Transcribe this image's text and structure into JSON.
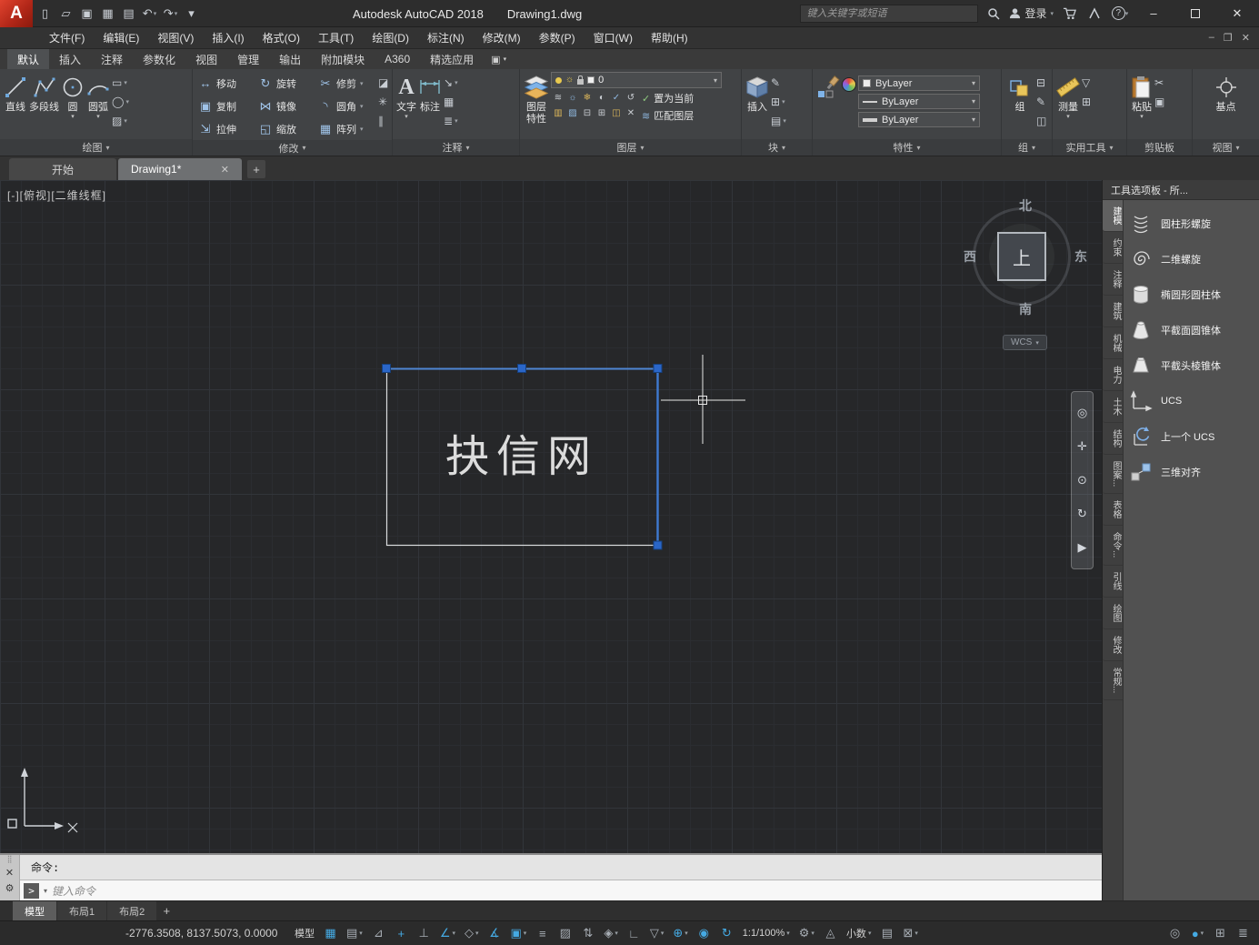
{
  "ui": {
    "caret_down": "▾",
    "close": "✕",
    "plus": "+",
    "minimize": "–",
    "restore": "❐",
    "menu_grip": "⣿",
    "gear": "⚙",
    "prompt": ">",
    "question": "?"
  },
  "titlebar": {
    "app_title": "Autodesk AutoCAD 2018",
    "doc_title": "Drawing1.dwg",
    "search_placeholder": "键入关键字或短语",
    "login_label": "登录",
    "quick_access": [
      {
        "name": "new-file-icon",
        "glyph": "▯"
      },
      {
        "name": "open-folder-icon",
        "glyph": "▱"
      },
      {
        "name": "save-icon",
        "glyph": "▣"
      },
      {
        "name": "save-as-icon",
        "glyph": "▦"
      },
      {
        "name": "plot-icon",
        "glyph": "▤"
      },
      {
        "name": "undo-icon",
        "glyph": "↶",
        "caret": "▾"
      },
      {
        "name": "redo-icon",
        "glyph": "↷",
        "caret": "▾"
      },
      {
        "name": "toolbar-customize-icon",
        "glyph": "▾"
      }
    ]
  },
  "menubar": {
    "items": [
      "文件(F)",
      "编辑(E)",
      "视图(V)",
      "插入(I)",
      "格式(O)",
      "工具(T)",
      "绘图(D)",
      "标注(N)",
      "修改(M)",
      "参数(P)",
      "窗口(W)",
      "帮助(H)"
    ]
  },
  "ribbon": {
    "tabs": [
      {
        "label": "默认",
        "active": true
      },
      {
        "label": "插入"
      },
      {
        "label": "注释"
      },
      {
        "label": "参数化"
      },
      {
        "label": "视图"
      },
      {
        "label": "管理"
      },
      {
        "label": "输出"
      },
      {
        "label": "附加模块"
      },
      {
        "label": "A360"
      },
      {
        "label": "精选应用"
      }
    ],
    "draw": {
      "title": "绘图",
      "line": "直线",
      "polyline": "多段线",
      "circle": "圆",
      "arc": "圆弧",
      "extra": [
        {
          "name": "rectangle-tool",
          "glyph": "▭",
          "caret": "▾"
        },
        {
          "name": "ellipse-tool",
          "glyph": "◯",
          "caret": "▾"
        },
        {
          "name": "hatch-tool",
          "glyph": "▨",
          "caret": "▾"
        }
      ]
    },
    "modify": {
      "title": "修改",
      "grid": [
        {
          "glyph": "↔",
          "label": "移动"
        },
        {
          "glyph": "↻",
          "label": "旋转"
        },
        {
          "glyph": "✂",
          "label": "修剪",
          "caret": "▾"
        },
        {
          "glyph": "▣",
          "label": "复制"
        },
        {
          "glyph": "⋈",
          "label": "镜像"
        },
        {
          "glyph": "◝",
          "label": "圆角",
          "caret": "▾"
        },
        {
          "glyph": "⇲",
          "label": "拉伸"
        },
        {
          "glyph": "◱",
          "label": "缩放"
        },
        {
          "glyph": "▦",
          "label": "阵列",
          "caret": "▾"
        }
      ],
      "extra": [
        {
          "name": "erase-tool",
          "glyph": "◪"
        },
        {
          "name": "explode-tool",
          "glyph": "✳"
        },
        {
          "name": "offset-tool",
          "glyph": "∥"
        }
      ]
    },
    "annotation": {
      "title": "注释",
      "text": "文字",
      "dimension": "标注",
      "extra": [
        {
          "name": "leader-tool",
          "glyph": "↘",
          "caret": "▾"
        },
        {
          "name": "table-tool",
          "glyph": "▦"
        },
        {
          "name": "dim-style-tool",
          "glyph": "≣",
          "caret": "▾"
        }
      ]
    },
    "layers": {
      "title": "图层",
      "props_line1": "图层",
      "props_line2": "特性",
      "combo_value": "0",
      "set_current": "置为当前",
      "match_layer": "匹配图层",
      "tools": [
        "≋",
        "☼",
        "❄",
        "◐",
        "✓",
        "↺",
        "▥",
        "▨",
        "⊟",
        "⊞",
        "◫",
        "✕"
      ]
    },
    "block": {
      "title": "块",
      "insert": "插入",
      "extra": [
        {
          "name": "block-edit-tool",
          "glyph": "✎"
        },
        {
          "name": "block-create-tool",
          "glyph": "⊞",
          "caret": "▾"
        },
        {
          "name": "block-attribute-tool",
          "glyph": "▤",
          "caret": "▾"
        }
      ]
    },
    "properties": {
      "title": "特性",
      "rows": [
        {
          "value": "ByLayer"
        },
        {
          "value": "ByLayer"
        },
        {
          "value": "ByLayer"
        }
      ]
    },
    "groups": {
      "title": "组",
      "group": "组",
      "extra": [
        {
          "name": "ungroup-tool",
          "glyph": "⊟"
        },
        {
          "name": "group-edit-tool",
          "glyph": "✎"
        },
        {
          "name": "group-select-tool",
          "glyph": "◫"
        }
      ]
    },
    "utilities": {
      "title": "实用工具",
      "measure": "测量",
      "extra": [
        {
          "name": "quick-select-tool",
          "glyph": "▽"
        },
        {
          "name": "quick-calc-tool",
          "glyph": "⊞"
        }
      ]
    },
    "clipboard": {
      "title": "剪贴板",
      "paste": "粘贴",
      "extra": [
        {
          "name": "cut-tool",
          "glyph": "✂"
        },
        {
          "name": "copy-clip-tool",
          "glyph": "▣"
        }
      ]
    },
    "view": {
      "title": "视图",
      "base": "基点"
    }
  },
  "filetabs": {
    "start": "开始",
    "drawing": "Drawing1*"
  },
  "canvas": {
    "viewport_label": "[-][俯视][二维线框]",
    "text_object": "抉信网",
    "viewcube": {
      "north": "北",
      "south": "南",
      "west": "西",
      "east": "东",
      "top": "上",
      "wcs": "WCS"
    },
    "navbar": [
      {
        "name": "steering-wheel-icon",
        "glyph": "◎"
      },
      {
        "name": "pan-icon",
        "glyph": "✛"
      },
      {
        "name": "zoom-icon",
        "glyph": "⊙"
      },
      {
        "name": "orbit-icon",
        "glyph": "↻"
      },
      {
        "name": "show-motion-icon",
        "glyph": "▶"
      }
    ]
  },
  "palette": {
    "title": "工具选项板 - 所...",
    "tabs": [
      {
        "label": "建模",
        "active": true
      },
      {
        "label": "约束"
      },
      {
        "label": "注释"
      },
      {
        "label": "建筑"
      },
      {
        "label": "机械"
      },
      {
        "label": "电力"
      },
      {
        "label": "土木"
      },
      {
        "label": "结构"
      },
      {
        "label": "图案..."
      },
      {
        "label": "表格"
      },
      {
        "label": "命令..."
      },
      {
        "label": "引线"
      },
      {
        "label": "绘图"
      },
      {
        "label": "修改"
      },
      {
        "label": "常规..."
      }
    ],
    "items": [
      {
        "label": "圆柱形螺旋"
      },
      {
        "label": "二维螺旋"
      },
      {
        "label": "椭圆形圆柱体"
      },
      {
        "label": "平截面圆锥体"
      },
      {
        "label": "平截头棱锥体"
      },
      {
        "label": "UCS"
      },
      {
        "label": "上一个 UCS"
      },
      {
        "label": "三维对齐"
      }
    ]
  },
  "command": {
    "prompt": "命令:",
    "placeholder": "键入命令"
  },
  "layouts": {
    "tabs": [
      {
        "label": "模型",
        "active": true
      },
      {
        "label": "布局1"
      },
      {
        "label": "布局2"
      }
    ]
  },
  "statusbar": {
    "coordinates": "-2776.3508, 8137.5073, 0.0000",
    "icons": [
      {
        "name": "model-paper-toggle",
        "text": "模型"
      },
      {
        "name": "grid-icon",
        "glyph": "▦",
        "active": true
      },
      {
        "name": "snap-icon",
        "glyph": "▤",
        "caret": "▾"
      },
      {
        "name": "infer-constraints-icon",
        "glyph": "⊿"
      },
      {
        "name": "dynamic-input-icon",
        "glyph": "+",
        "active": true
      },
      {
        "name": "ortho-icon",
        "glyph": "⊥"
      },
      {
        "name": "polar-tracking-icon",
        "glyph": "∠",
        "active": true,
        "caret": "▾"
      },
      {
        "name": "iso-drafting-icon",
        "glyph": "◇",
        "caret": "▾"
      },
      {
        "name": "osnap-tracking-icon",
        "glyph": "∡",
        "active": true
      },
      {
        "name": "osnap-icon",
        "glyph": "▣",
        "active": true,
        "caret": "▾"
      },
      {
        "name": "lineweight-icon",
        "glyph": "≡"
      },
      {
        "name": "transparency-icon",
        "glyph": "▨"
      },
      {
        "name": "selection-cycling-icon",
        "glyph": "⇅"
      },
      {
        "name": "osnap-3d-icon",
        "glyph": "◈",
        "caret": "▾"
      },
      {
        "name": "dynamic-ucs-icon",
        "glyph": "∟"
      },
      {
        "name": "selection-filter-icon",
        "glyph": "▽",
        "caret": "▾"
      },
      {
        "name": "gizmo-icon",
        "glyph": "⊕",
        "active": true,
        "caret": "▾"
      },
      {
        "name": "annotation-visibility-icon",
        "glyph": "◉",
        "active": true
      },
      {
        "name": "autoscale-icon",
        "glyph": "↻",
        "active": true
      },
      {
        "name": "annotation-scale",
        "text": "1:1/100%",
        "caret": "▾"
      },
      {
        "name": "workspace-icon",
        "glyph": "⚙",
        "caret": "▾"
      },
      {
        "name": "annotation-monitor-icon",
        "glyph": "◬"
      },
      {
        "name": "units",
        "text": "小数",
        "caret": "▾"
      },
      {
        "name": "quick-properties-icon",
        "glyph": "▤"
      },
      {
        "name": "lock-ui-icon",
        "glyph": "⊠",
        "caret": "▾"
      }
    ],
    "right_icons": [
      {
        "name": "isolate-objects-icon",
        "glyph": "◎"
      },
      {
        "name": "graphics-performance-icon",
        "glyph": "●",
        "active": true,
        "caret": "▾"
      },
      {
        "name": "clean-screen-icon",
        "glyph": "⊞"
      },
      {
        "name": "customization-icon",
        "glyph": "≣"
      }
    ]
  }
}
